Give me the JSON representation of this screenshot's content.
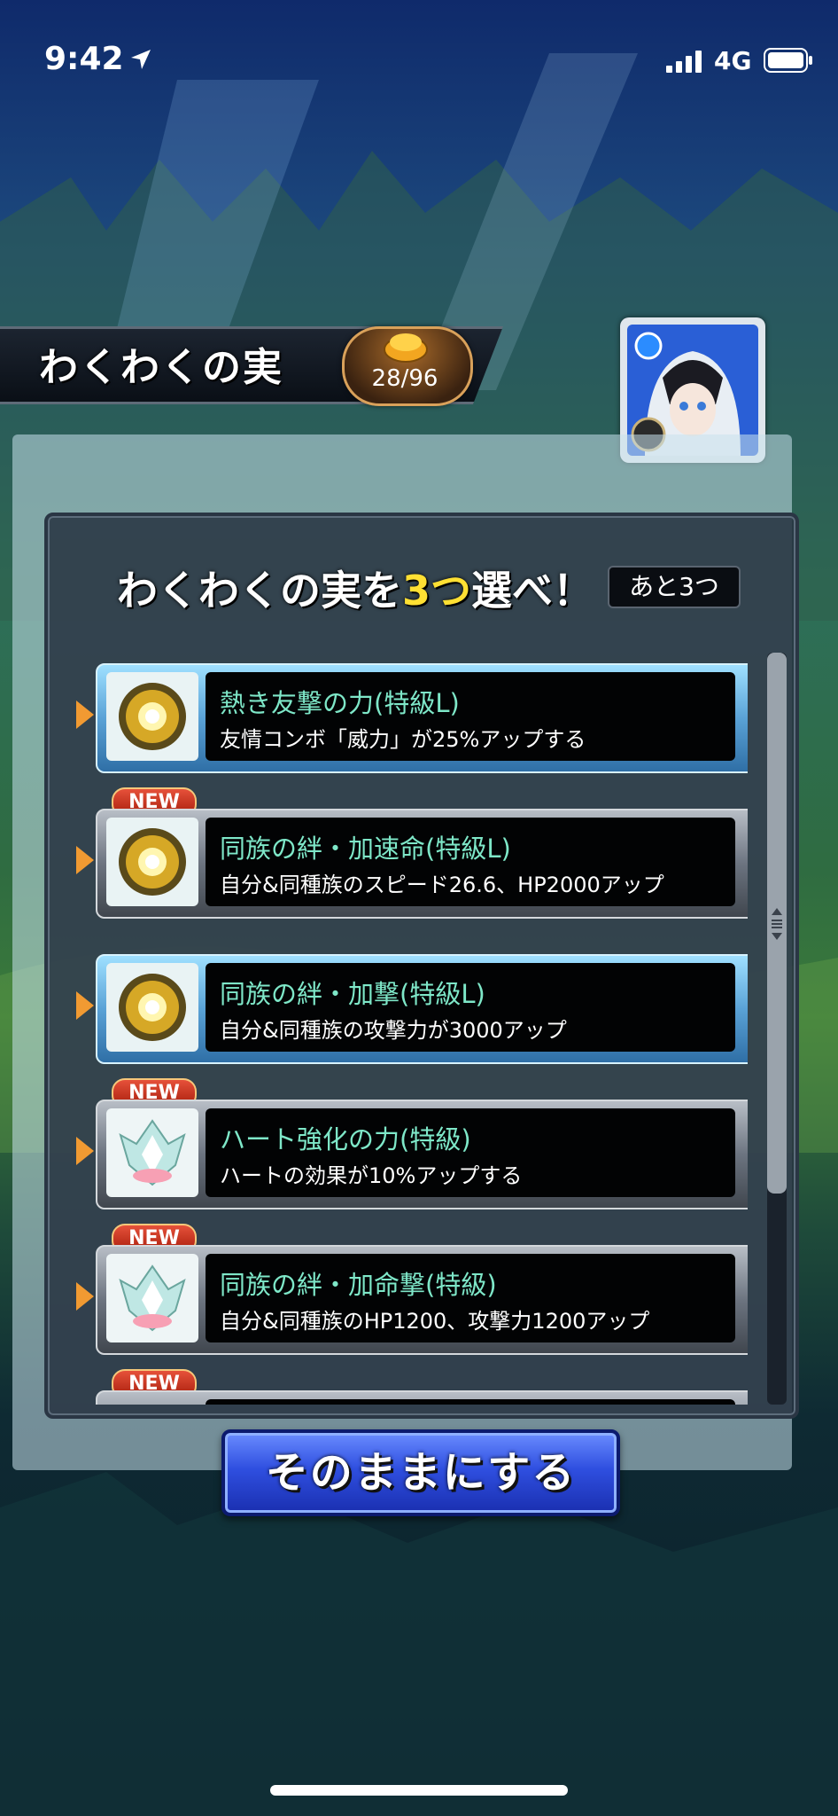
{
  "status_bar": {
    "time": "9:42",
    "network": "4G"
  },
  "header": {
    "title": "わくわくの実",
    "counter": "28/96"
  },
  "prompt": {
    "before": "わくわくの実を",
    "highlight": "3つ",
    "after": "選べ！",
    "remaining": "あと3つ"
  },
  "items": [
    {
      "name": "熱き友撃の力(特級L)",
      "desc": "友情コンボ「威力」が25%アップする",
      "is_new": false,
      "selected": true,
      "icon": "gold-fruit-icon"
    },
    {
      "name": "同族の絆・加速命(特級L)",
      "desc": "自分&同種族のスピード26.6、HP2000アップ",
      "is_new": true,
      "selected": false,
      "icon": "gold-fruit-icon"
    },
    {
      "name": "同族の絆・加撃(特級L)",
      "desc": "自分&同種族の攻撃力が3000アップ",
      "is_new": false,
      "selected": true,
      "icon": "gold-fruit-icon"
    },
    {
      "name": "ハート強化の力(特級)",
      "desc": "ハートの効果が10%アップする",
      "is_new": true,
      "selected": false,
      "icon": "lotus-fruit-icon"
    },
    {
      "name": "同族の絆・加命撃(特級)",
      "desc": "自分&同種族のHP1200、攻撃力1200アップ",
      "is_new": true,
      "selected": false,
      "icon": "lotus-fruit-icon"
    },
    {
      "name": "",
      "desc": "",
      "is_new": true,
      "selected": false,
      "icon": ""
    }
  ],
  "new_label": "NEW",
  "button": {
    "label": "そのままにする"
  },
  "colors": {
    "accent": "#ffe033",
    "item_name": "#7ee7c8",
    "button": "#2f4fe0"
  }
}
